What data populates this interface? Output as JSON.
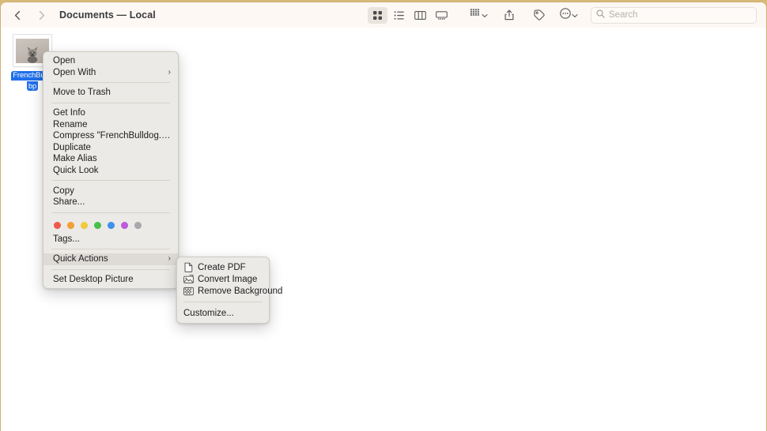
{
  "window": {
    "title": "Documents — Local",
    "back_icon": "chevron-left-icon",
    "forward_icon": "chevron-right-icon"
  },
  "toolbar": {
    "view_modes": [
      {
        "name": "icon-view",
        "icon": "grid-icon",
        "selected": true
      },
      {
        "name": "list-view",
        "icon": "list-icon",
        "selected": false
      },
      {
        "name": "column-view",
        "icon": "columns-icon",
        "selected": false
      },
      {
        "name": "gallery-view",
        "icon": "gallery-icon",
        "selected": false
      }
    ],
    "group_by": {
      "name": "group-by",
      "icon": "group-icon",
      "chevron": "chevron-down-icon"
    },
    "share": {
      "name": "share",
      "icon": "share-icon"
    },
    "tags": {
      "name": "tags",
      "icon": "tag-icon"
    },
    "more": {
      "name": "more-options",
      "icon": "circle-ellipsis-icon",
      "chevron": "chevron-down-icon"
    }
  },
  "search": {
    "placeholder": "Search",
    "value": "",
    "icon": "search-icon"
  },
  "file": {
    "name": "FrenchBulldog.webp",
    "label_line1": "FrenchBulld",
    "label_line2": "bp",
    "selected": true,
    "thumbnail": "french-bulldog-photo"
  },
  "context_menu": {
    "groups": [
      {
        "items": [
          {
            "label": "Open",
            "submenu": false,
            "highlighted": false
          },
          {
            "label": "Open With",
            "submenu": true,
            "highlighted": false
          }
        ]
      },
      {
        "items": [
          {
            "label": "Move to Trash",
            "submenu": false,
            "highlighted": false
          }
        ]
      },
      {
        "items": [
          {
            "label": "Get Info",
            "submenu": false,
            "highlighted": false
          },
          {
            "label": "Rename",
            "submenu": false,
            "highlighted": false
          },
          {
            "label": "Compress \"FrenchBulldog.webp\"",
            "submenu": false,
            "highlighted": false
          },
          {
            "label": "Duplicate",
            "submenu": false,
            "highlighted": false
          },
          {
            "label": "Make Alias",
            "submenu": false,
            "highlighted": false
          },
          {
            "label": "Quick Look",
            "submenu": false,
            "highlighted": false
          }
        ]
      },
      {
        "items": [
          {
            "label": "Copy",
            "submenu": false,
            "highlighted": false
          },
          {
            "label": "Share...",
            "submenu": false,
            "highlighted": false
          }
        ]
      }
    ],
    "tag_colors": [
      {
        "name": "red",
        "hex": "#f0584c"
      },
      {
        "name": "orange",
        "hex": "#f3a033"
      },
      {
        "name": "yellow",
        "hex": "#f2cb3a"
      },
      {
        "name": "green",
        "hex": "#48c04a"
      },
      {
        "name": "blue",
        "hex": "#3d92ef"
      },
      {
        "name": "purple",
        "hex": "#be5ae0"
      },
      {
        "name": "gray",
        "hex": "#a8a8ad"
      }
    ],
    "tags_item": {
      "label": "Tags...",
      "submenu": false,
      "highlighted": false
    },
    "quick_actions": {
      "label": "Quick Actions",
      "submenu": true,
      "highlighted": true
    },
    "set_desktop": {
      "label": "Set Desktop Picture",
      "submenu": false,
      "highlighted": false
    }
  },
  "quick_actions_submenu": {
    "items": [
      {
        "label": "Create PDF",
        "icon": "document-icon"
      },
      {
        "label": "Convert Image",
        "icon": "photo-convert-icon"
      },
      {
        "label": "Remove Background",
        "icon": "remove-background-icon"
      }
    ],
    "customize": {
      "label": "Customize..."
    }
  },
  "colors": {
    "accent_selection": "#1f6feb",
    "toolbar_bg": "#fdf8f4",
    "menu_bg": "#eceae6",
    "menu_highlight": "#dedbd6",
    "content_bg": "#ffffff",
    "desktop_strip": "#d8b978"
  }
}
